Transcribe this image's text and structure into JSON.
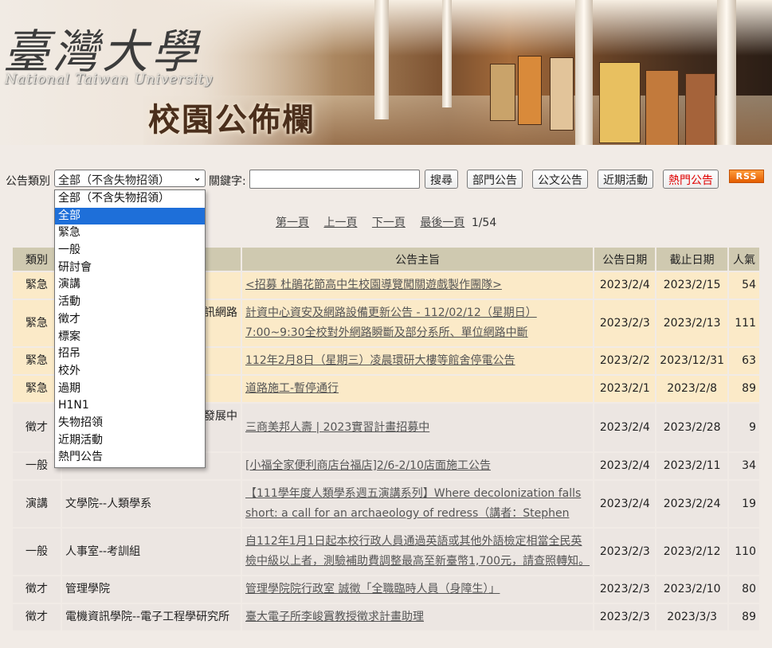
{
  "banner": {
    "logo_cn": "臺灣大學",
    "logo_en": "National Taiwan University",
    "title": "校園公佈欄"
  },
  "search": {
    "category_label": "公告類別",
    "category_selected": "全部（不含失物招領）",
    "keyword_label": "關鍵字:",
    "keyword_value": "",
    "search_btn": "搜尋",
    "dept_btn": "部門公告",
    "doc_btn": "公文公告",
    "events_btn": "近期活動",
    "hot_btn": "熱門公告",
    "rss": "RSS"
  },
  "dropdown_options": [
    "全部（不含失物招領）",
    "全部",
    "緊急",
    "一般",
    "研討會",
    "演講",
    "活動",
    "徵才",
    "標案",
    "招吊",
    "校外",
    "過期",
    "H1N1",
    "失物招領",
    "近期活動",
    "熱門公告"
  ],
  "pager": {
    "first": "第一頁",
    "prev": "上一頁",
    "next": "下一頁",
    "last": "最後一頁",
    "page_info": "1/54"
  },
  "table": {
    "headers": {
      "cat": "類別",
      "dept": "",
      "subj": "公告主旨",
      "date": "公告日期",
      "end": "截止日期",
      "views": "人氣"
    },
    "rows": [
      {
        "cat": "緊急",
        "dept": "",
        "subj": "<招募 杜鵑花節高中生校園導覽闖關遊戲製作團隊>",
        "date": "2023/2/4",
        "end": "2023/2/15",
        "views": "54"
      },
      {
        "cat": "緊急",
        "dept": "訊網路",
        "subj": "計資中心資安及網路設備更新公告 - 112/02/12（星期日）7:00~9:30全校對外網路瞬斷及部分系所、單位網路中斷",
        "date": "2023/2/3",
        "end": "2023/2/13",
        "views": "111"
      },
      {
        "cat": "緊急",
        "dept": "",
        "subj": "112年2月8日（星期三）凌晨環研大樓等館舍停電公告",
        "date": "2023/2/2",
        "end": "2023/12/31",
        "views": "63"
      },
      {
        "cat": "緊急",
        "dept": "",
        "subj": "道路施工-暫停通行",
        "date": "2023/2/1",
        "end": "2023/2/8",
        "views": "89"
      },
      {
        "cat": "徵才",
        "dept": "發展中",
        "subj": "三商美邦人壽 | 2023實習計畫招募中",
        "date": "2023/2/4",
        "end": "2023/2/28",
        "views": "9"
      },
      {
        "cat": "一般",
        "dept": "",
        "subj": "[小福全家便利商店台福店]2/6-2/10店面施工公告",
        "date": "2023/2/4",
        "end": "2023/2/11",
        "views": "34"
      },
      {
        "cat": "演講",
        "dept": "文學院--人類學系",
        "subj": "【111學年度人類學系週五演講系列】Where decolonization falls short: a call for an archaeology of redress（講者：Stephen",
        "date": "2023/2/4",
        "end": "2023/2/24",
        "views": "19"
      },
      {
        "cat": "一般",
        "dept": "人事室--考訓組",
        "subj": "自112年1月1日起本校行政人員通過英語或其他外語檢定相當全民英檢中級以上者，測驗補助費調整最高至新臺幣1,700元，請查照轉知。",
        "date": "2023/2/3",
        "end": "2023/2/12",
        "views": "110"
      },
      {
        "cat": "徵才",
        "dept": "管理學院",
        "subj": "管理學院院行政室 誠徵「全職臨時人員（身障生）」",
        "date": "2023/2/3",
        "end": "2023/2/10",
        "views": "80"
      },
      {
        "cat": "徵才",
        "dept": "電機資訊學院--電子工程學研究所",
        "subj": "臺大電子所李峻霣教授徵求計畫助理",
        "date": "2023/2/3",
        "end": "2023/3/3",
        "views": "89"
      }
    ]
  }
}
